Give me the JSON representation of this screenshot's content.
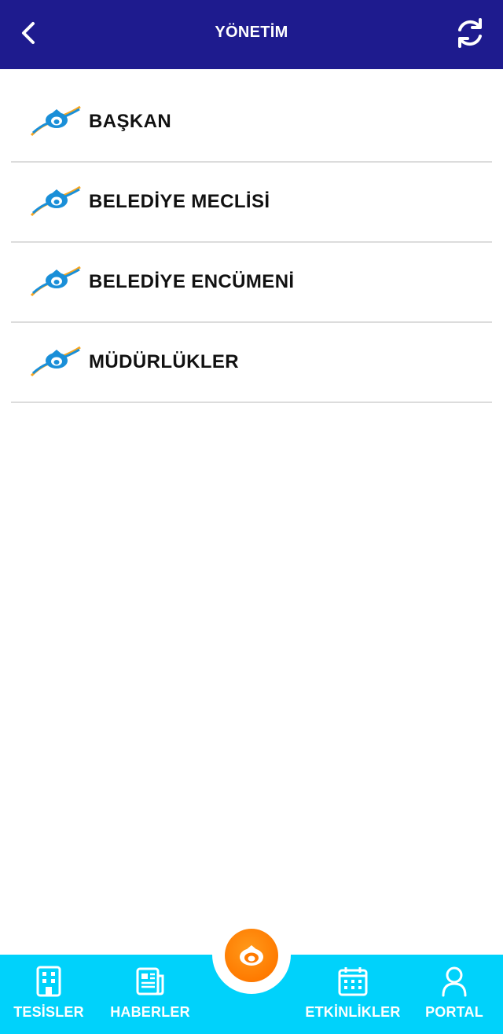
{
  "header": {
    "title": "YÖNETİM",
    "back_icon": "chevron-left-icon",
    "refresh_icon": "refresh-icon",
    "background": "#1e1b8e"
  },
  "menu": {
    "items": [
      {
        "label": "BAŞKAN",
        "icon": "municipality-logo-icon"
      },
      {
        "label": "BELEDİYE MECLİSİ",
        "icon": "municipality-logo-icon"
      },
      {
        "label": "BELEDİYE ENCÜMENİ",
        "icon": "municipality-logo-icon"
      },
      {
        "label": "MÜDÜRLÜKLER",
        "icon": "municipality-logo-icon"
      }
    ]
  },
  "bottom_nav": {
    "background": "#00d2fb",
    "center_button_color": "#ff7a00",
    "items": [
      {
        "label": "TESİSLER",
        "icon": "building-icon"
      },
      {
        "label": "HABERLER",
        "icon": "newspaper-icon"
      },
      {
        "label": "ETKİNLİKLER",
        "icon": "calendar-icon"
      },
      {
        "label": "PORTAL",
        "icon": "user-icon"
      }
    ]
  }
}
